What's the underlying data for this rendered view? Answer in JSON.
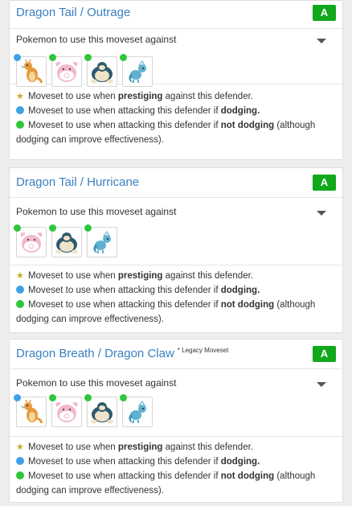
{
  "against_label": "Pokemon to use this moveset against",
  "legend": {
    "prestige_pre": "Moveset to use when ",
    "prestige_bold": "prestiging",
    "prestige_post": " against this defender.",
    "dodge_pre": "Moveset to use when attacking this defender if ",
    "dodge_bold": "dodging.",
    "nododge_pre": "Moveset to use when attacking this defender if ",
    "nododge_bold": "not dodging",
    "nododge_post": " (although",
    "nododge_cont": "dodging can improve effectiveness)."
  },
  "colors": {
    "dodging": "#3fa1e8",
    "not_dodging": "#2ec63c",
    "prestige": "#c9a826",
    "grade": "#12a81c",
    "title": "#3a7fc0"
  },
  "cards": [
    {
      "fast": "Dragon Tail",
      "sep": " / ",
      "charge": "Outrage",
      "legacy": "",
      "grade": "A",
      "pokemon": [
        {
          "name": "Dragonite",
          "dot": "dodging"
        },
        {
          "name": "Blissey",
          "dot": "not_dodging"
        },
        {
          "name": "Snorlax",
          "dot": "not_dodging"
        },
        {
          "name": "Vaporeon",
          "dot": "not_dodging"
        }
      ]
    },
    {
      "fast": "Dragon Tail",
      "sep": " / ",
      "charge": "Hurricane",
      "legacy": "",
      "grade": "A",
      "pokemon": [
        {
          "name": "Blissey",
          "dot": "not_dodging"
        },
        {
          "name": "Snorlax",
          "dot": "not_dodging"
        },
        {
          "name": "Vaporeon",
          "dot": "not_dodging"
        }
      ]
    },
    {
      "fast": "Dragon Breath",
      "sep": " / ",
      "charge": "Dragon Claw",
      "legacy": "* Legacy Moveset",
      "grade": "A",
      "pokemon": [
        {
          "name": "Dragonite",
          "dot": "dodging"
        },
        {
          "name": "Blissey",
          "dot": "not_dodging"
        },
        {
          "name": "Snorlax",
          "dot": "not_dodging"
        },
        {
          "name": "Vaporeon",
          "dot": "not_dodging"
        }
      ]
    }
  ]
}
